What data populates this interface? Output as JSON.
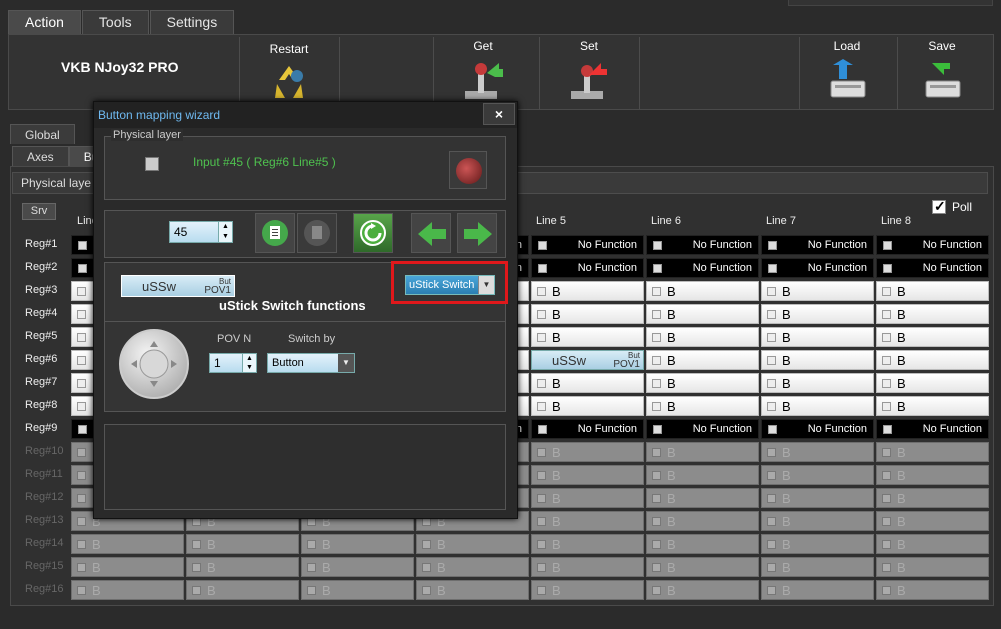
{
  "top_tabs": [
    "Action",
    "Tools",
    "Settings"
  ],
  "device_name": "VKB NJoy32 PRO",
  "toolbar": {
    "restart": "Restart",
    "get": "Get",
    "set": "Set",
    "load": "Load",
    "save": "Save"
  },
  "sub_tabs1": [
    "Global"
  ],
  "sub_tabs2": [
    "Axes",
    "Butt"
  ],
  "physical_layer_label": "Physical laye",
  "srv_label": "Srv",
  "poll_label": "Poll",
  "columns": [
    "Line",
    "Line 5",
    "Line 6",
    "Line 7",
    "Line 8"
  ],
  "rows": [
    "Reg#1",
    "Reg#2",
    "Reg#3",
    "Reg#4",
    "Reg#5",
    "Reg#6",
    "Reg#7",
    "Reg#8",
    "Reg#9",
    "Reg#10",
    "Reg#11",
    "Reg#12",
    "Reg#13",
    "Reg#14",
    "Reg#15",
    "Reg#16"
  ],
  "cell_texts": {
    "no_function": "No Function",
    "b": "B",
    "ussw_main": "uSSw",
    "ussw_sup": "But",
    "ussw_sub": "POV1"
  },
  "dialog": {
    "title": "Button mapping wizard",
    "close": "×",
    "physical_layer": "Physical layer",
    "input_text": "Input #45  ( Reg#6  Line#5 )",
    "input_number": "45",
    "function_main": "uSSw",
    "function_sup": "But",
    "function_sub": "POV1",
    "function_type": "uStick Switch",
    "functions_title": "uStick Switch functions",
    "pov_label": "POV N",
    "pov_value": "1",
    "switch_by_label": "Switch by",
    "switch_by_value": "Button"
  }
}
